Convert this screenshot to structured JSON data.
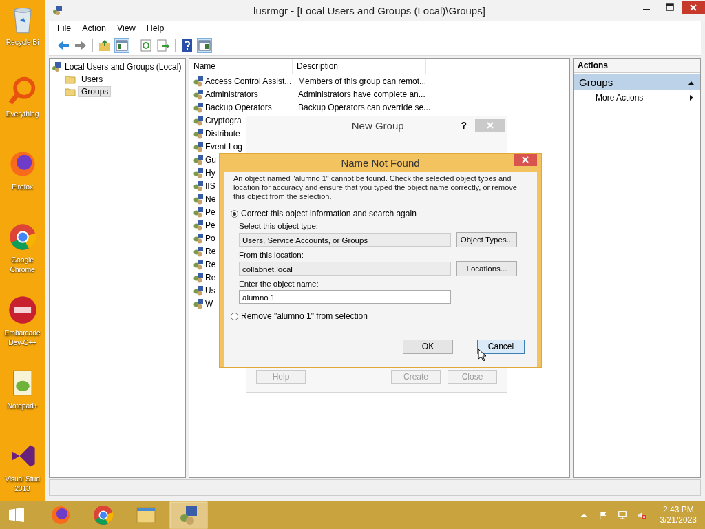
{
  "desktop_icons": [
    {
      "kind": "recycle",
      "lines": [
        "Recycle Bi"
      ]
    },
    {
      "kind": "search",
      "lines": [
        "Everything"
      ]
    },
    {
      "kind": "firefox",
      "lines": [
        "Firefox"
      ]
    },
    {
      "kind": "chrome",
      "lines": [
        "Google",
        "Chrome"
      ]
    },
    {
      "kind": "devcpp",
      "lines": [
        "Embarcade",
        "Dev-C++"
      ]
    },
    {
      "kind": "notepad",
      "lines": [
        "Notepad+"
      ]
    },
    {
      "kind": "vs",
      "lines": [
        "Visual Stud",
        "2013"
      ]
    }
  ],
  "window": {
    "title": "lusrmgr - [Local Users and Groups (Local)\\Groups]",
    "menu": [
      "File",
      "Action",
      "View",
      "Help"
    ],
    "toolbar": [
      {
        "kind": "back",
        "pressed": false
      },
      {
        "kind": "forward",
        "pressed": false
      },
      {
        "kind": "sep"
      },
      {
        "kind": "up",
        "pressed": false
      },
      {
        "kind": "tree",
        "pressed": true
      },
      {
        "kind": "sep"
      },
      {
        "kind": "refresh",
        "pressed": false
      },
      {
        "kind": "export",
        "pressed": false
      },
      {
        "kind": "sep"
      },
      {
        "kind": "help",
        "pressed": false
      },
      {
        "kind": "pane",
        "pressed": true
      }
    ],
    "tree": {
      "label": "Local Users and Groups (Local)",
      "children": [
        {
          "label": "Users",
          "selected": false
        },
        {
          "label": "Groups",
          "selected": true
        }
      ]
    },
    "list": {
      "columns": [
        "Name",
        "Description"
      ],
      "rows": [
        {
          "name": "Access Control Assist...",
          "description": "Members of this group can remot..."
        },
        {
          "name": "Administrators",
          "description": "Administrators have complete an..."
        },
        {
          "name": "Backup Operators",
          "description": "Backup Operators can override se..."
        },
        {
          "name": "Cryptogra"
        },
        {
          "name": "Distribute"
        },
        {
          "name": "Event Log"
        },
        {
          "name": "Gu"
        },
        {
          "name": "Hy"
        },
        {
          "name": "IIS"
        },
        {
          "name": "Ne"
        },
        {
          "name": "Pe"
        },
        {
          "name": "Pe"
        },
        {
          "name": "Po"
        },
        {
          "name": "Re"
        },
        {
          "name": "Re"
        },
        {
          "name": "Re"
        },
        {
          "name": "Us"
        },
        {
          "name": "W"
        }
      ]
    },
    "actions": {
      "header": "Actions",
      "section": {
        "label": "Groups",
        "expanded": true
      },
      "items": [
        "More Actions"
      ]
    }
  },
  "new_group": {
    "title": "New Group",
    "help": "?",
    "buttons": [
      "Help",
      "Create",
      "Close"
    ]
  },
  "name_not_found": {
    "title": "Name Not Found",
    "message": "An object named \"alumno 1\" cannot be found. Check the selected object types and location for accuracy and ensure that you typed the object name correctly, or remove this object from the selection.",
    "options": [
      {
        "label": "Correct this object information and search again",
        "selected": true
      },
      {
        "label": "Remove \"alumno 1\" from selection",
        "selected": false
      }
    ],
    "fields": [
      {
        "label": "Select this object type:",
        "value": "Users, Service Accounts, or Groups",
        "button": "Object Types...",
        "editable": false
      },
      {
        "label": "From this location:",
        "value": "collabnet.local",
        "button": "Locations...",
        "editable": false
      },
      {
        "label": "Enter the object name:",
        "value": "alumno 1",
        "editable": true
      }
    ],
    "buttons": [
      {
        "label": "OK",
        "hovered": false
      },
      {
        "label": "Cancel",
        "hovered": true
      }
    ]
  },
  "taskbar": {
    "apps": [
      {
        "kind": "firefox",
        "active": false
      },
      {
        "kind": "chrome",
        "active": false
      },
      {
        "kind": "explorer",
        "active": false
      },
      {
        "kind": "mmc",
        "active": true
      }
    ],
    "time": "2:43 PM",
    "date": "3/21/2023"
  }
}
